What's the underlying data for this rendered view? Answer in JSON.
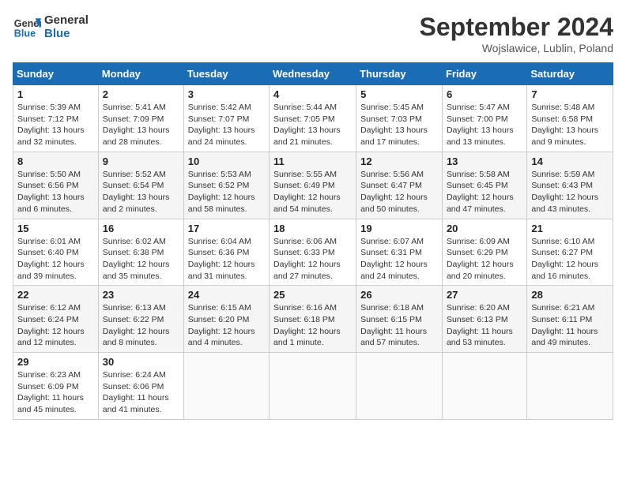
{
  "header": {
    "logo_line1": "General",
    "logo_line2": "Blue",
    "month_title": "September 2024",
    "location": "Wojslawice, Lublin, Poland"
  },
  "days_of_week": [
    "Sunday",
    "Monday",
    "Tuesday",
    "Wednesday",
    "Thursday",
    "Friday",
    "Saturday"
  ],
  "weeks": [
    [
      {
        "day": "1",
        "sunrise": "5:39 AM",
        "sunset": "7:12 PM",
        "daylight": "13 hours and 32 minutes."
      },
      {
        "day": "2",
        "sunrise": "5:41 AM",
        "sunset": "7:09 PM",
        "daylight": "13 hours and 28 minutes."
      },
      {
        "day": "3",
        "sunrise": "5:42 AM",
        "sunset": "7:07 PM",
        "daylight": "13 hours and 24 minutes."
      },
      {
        "day": "4",
        "sunrise": "5:44 AM",
        "sunset": "7:05 PM",
        "daylight": "13 hours and 21 minutes."
      },
      {
        "day": "5",
        "sunrise": "5:45 AM",
        "sunset": "7:03 PM",
        "daylight": "13 hours and 17 minutes."
      },
      {
        "day": "6",
        "sunrise": "5:47 AM",
        "sunset": "7:00 PM",
        "daylight": "13 hours and 13 minutes."
      },
      {
        "day": "7",
        "sunrise": "5:48 AM",
        "sunset": "6:58 PM",
        "daylight": "13 hours and 9 minutes."
      }
    ],
    [
      {
        "day": "8",
        "sunrise": "5:50 AM",
        "sunset": "6:56 PM",
        "daylight": "13 hours and 6 minutes."
      },
      {
        "day": "9",
        "sunrise": "5:52 AM",
        "sunset": "6:54 PM",
        "daylight": "13 hours and 2 minutes."
      },
      {
        "day": "10",
        "sunrise": "5:53 AM",
        "sunset": "6:52 PM",
        "daylight": "12 hours and 58 minutes."
      },
      {
        "day": "11",
        "sunrise": "5:55 AM",
        "sunset": "6:49 PM",
        "daylight": "12 hours and 54 minutes."
      },
      {
        "day": "12",
        "sunrise": "5:56 AM",
        "sunset": "6:47 PM",
        "daylight": "12 hours and 50 minutes."
      },
      {
        "day": "13",
        "sunrise": "5:58 AM",
        "sunset": "6:45 PM",
        "daylight": "12 hours and 47 minutes."
      },
      {
        "day": "14",
        "sunrise": "5:59 AM",
        "sunset": "6:43 PM",
        "daylight": "12 hours and 43 minutes."
      }
    ],
    [
      {
        "day": "15",
        "sunrise": "6:01 AM",
        "sunset": "6:40 PM",
        "daylight": "12 hours and 39 minutes."
      },
      {
        "day": "16",
        "sunrise": "6:02 AM",
        "sunset": "6:38 PM",
        "daylight": "12 hours and 35 minutes."
      },
      {
        "day": "17",
        "sunrise": "6:04 AM",
        "sunset": "6:36 PM",
        "daylight": "12 hours and 31 minutes."
      },
      {
        "day": "18",
        "sunrise": "6:06 AM",
        "sunset": "6:33 PM",
        "daylight": "12 hours and 27 minutes."
      },
      {
        "day": "19",
        "sunrise": "6:07 AM",
        "sunset": "6:31 PM",
        "daylight": "12 hours and 24 minutes."
      },
      {
        "day": "20",
        "sunrise": "6:09 AM",
        "sunset": "6:29 PM",
        "daylight": "12 hours and 20 minutes."
      },
      {
        "day": "21",
        "sunrise": "6:10 AM",
        "sunset": "6:27 PM",
        "daylight": "12 hours and 16 minutes."
      }
    ],
    [
      {
        "day": "22",
        "sunrise": "6:12 AM",
        "sunset": "6:24 PM",
        "daylight": "12 hours and 12 minutes."
      },
      {
        "day": "23",
        "sunrise": "6:13 AM",
        "sunset": "6:22 PM",
        "daylight": "12 hours and 8 minutes."
      },
      {
        "day": "24",
        "sunrise": "6:15 AM",
        "sunset": "6:20 PM",
        "daylight": "12 hours and 4 minutes."
      },
      {
        "day": "25",
        "sunrise": "6:16 AM",
        "sunset": "6:18 PM",
        "daylight": "12 hours and 1 minute."
      },
      {
        "day": "26",
        "sunrise": "6:18 AM",
        "sunset": "6:15 PM",
        "daylight": "11 hours and 57 minutes."
      },
      {
        "day": "27",
        "sunrise": "6:20 AM",
        "sunset": "6:13 PM",
        "daylight": "11 hours and 53 minutes."
      },
      {
        "day": "28",
        "sunrise": "6:21 AM",
        "sunset": "6:11 PM",
        "daylight": "11 hours and 49 minutes."
      }
    ],
    [
      {
        "day": "29",
        "sunrise": "6:23 AM",
        "sunset": "6:09 PM",
        "daylight": "11 hours and 45 minutes."
      },
      {
        "day": "30",
        "sunrise": "6:24 AM",
        "sunset": "6:06 PM",
        "daylight": "11 hours and 41 minutes."
      },
      null,
      null,
      null,
      null,
      null
    ]
  ]
}
